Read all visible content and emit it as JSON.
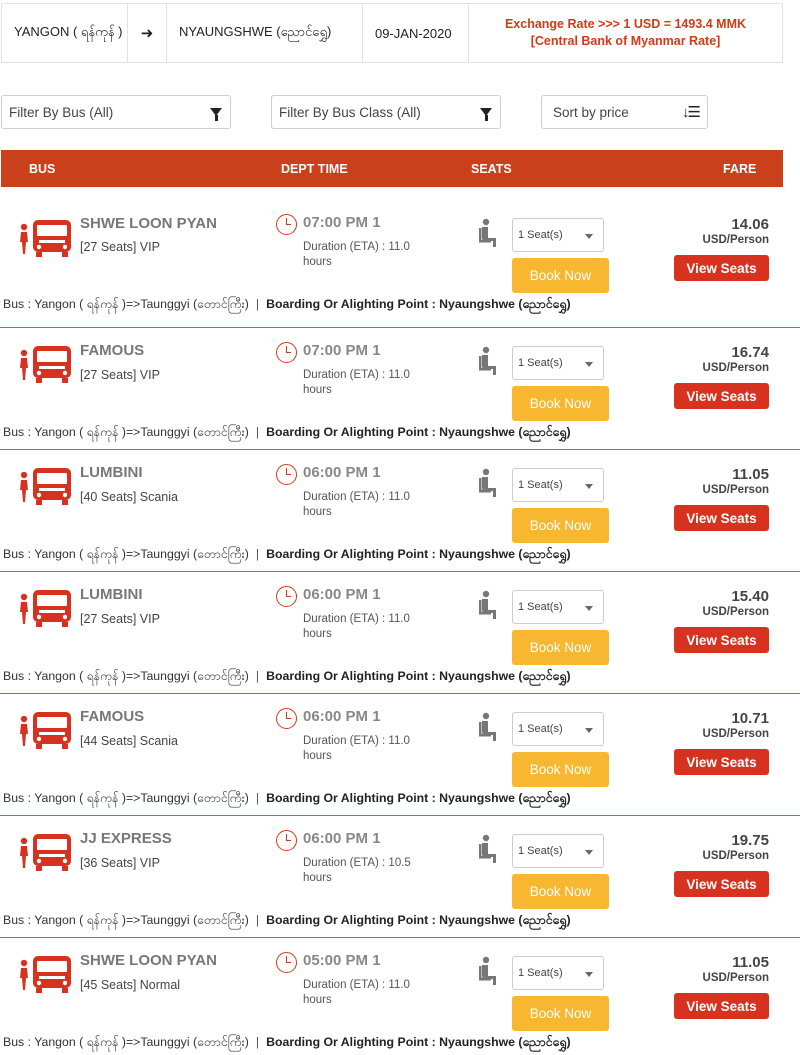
{
  "route_bar": {
    "origin": "YANGON ( ရန်ကုန် )",
    "arrow": "➜",
    "destination": "NYAUNGSHWE (ညောင်ရွှေ)",
    "date": "09-JAN-2020",
    "exchange_rate_line1": "Exchange Rate >>> 1 USD = 1493.4 MMK",
    "exchange_rate_line2": "[Central Bank of Myanmar Rate]"
  },
  "filters": {
    "bus": "Filter By Bus (All)",
    "bus_class": "Filter By Bus Class (All)",
    "sort": "Sort by price"
  },
  "table_header": {
    "bus": "BUS",
    "dept_time": "DEPT TIME",
    "seats": "SEATS",
    "fare": "FARE"
  },
  "labels": {
    "duration_prefix": "Duration (ETA) :",
    "hours": "hours",
    "book_now": "Book Now",
    "view_seats": "View Seats",
    "fare_unit": "USD/Person",
    "seat_default": "1 Seat(s)",
    "route_text": "Bus : Yangon ( ရန်ကုန် )=>Taunggyi (တောင်ကြီး)",
    "separator": "|",
    "boarding_text": "Boarding Or Alighting Point : Nyaungshwe (ညောင်ရွှေ)"
  },
  "colors": {
    "accent_red": "#c9401a",
    "book_yellow": "#f7b731",
    "view_red": "#d7321f"
  },
  "trips": [
    {
      "operator": "SHWE LOON PYAN",
      "bus_class": "[27 Seats] VIP",
      "dept_time": "07:00 PM 1",
      "duration": "11.0",
      "fare": "14.06"
    },
    {
      "operator": "FAMOUS",
      "bus_class": "[27 Seats] VIP",
      "dept_time": "07:00 PM 1",
      "duration": "11.0",
      "fare": "16.74"
    },
    {
      "operator": "LUMBINI",
      "bus_class": "[40 Seats] Scania",
      "dept_time": "06:00 PM 1",
      "duration": "11.0",
      "fare": "11.05"
    },
    {
      "operator": "LUMBINI",
      "bus_class": "[27 Seats] VIP",
      "dept_time": "06:00 PM 1",
      "duration": "11.0",
      "fare": "15.40"
    },
    {
      "operator": "FAMOUS",
      "bus_class": "[44 Seats] Scania",
      "dept_time": "06:00 PM 1",
      "duration": "11.0",
      "fare": "10.71"
    },
    {
      "operator": "JJ EXPRESS",
      "bus_class": "[36 Seats] VIP",
      "dept_time": "06:00 PM 1",
      "duration": "10.5",
      "fare": "19.75"
    },
    {
      "operator": "SHWE LOON PYAN",
      "bus_class": "[45 Seats] Normal",
      "dept_time": "05:00 PM 1",
      "duration": "11.0",
      "fare": "11.05"
    }
  ]
}
